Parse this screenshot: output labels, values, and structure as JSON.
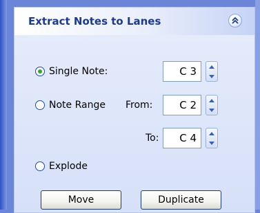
{
  "panel": {
    "title": "Extract Notes to Lanes",
    "collapse_icon": "double-chevron-up-icon"
  },
  "options": {
    "single_note": {
      "label": "Single Note:",
      "checked": true,
      "value": "C 3"
    },
    "note_range": {
      "label": "Note Range",
      "checked": false,
      "from_label": "From:",
      "from_value": "C 2",
      "to_label": "To:",
      "to_value": "C 4"
    },
    "explode": {
      "label": "Explode",
      "checked": false
    }
  },
  "buttons": {
    "move_label": "Move",
    "duplicate_label": "Duplicate"
  },
  "colors": {
    "title_text": "#1e3a8a",
    "radio_dot": "#2fa834",
    "panel_background": "#dfe7fa",
    "side_band": "#6b86d6"
  }
}
